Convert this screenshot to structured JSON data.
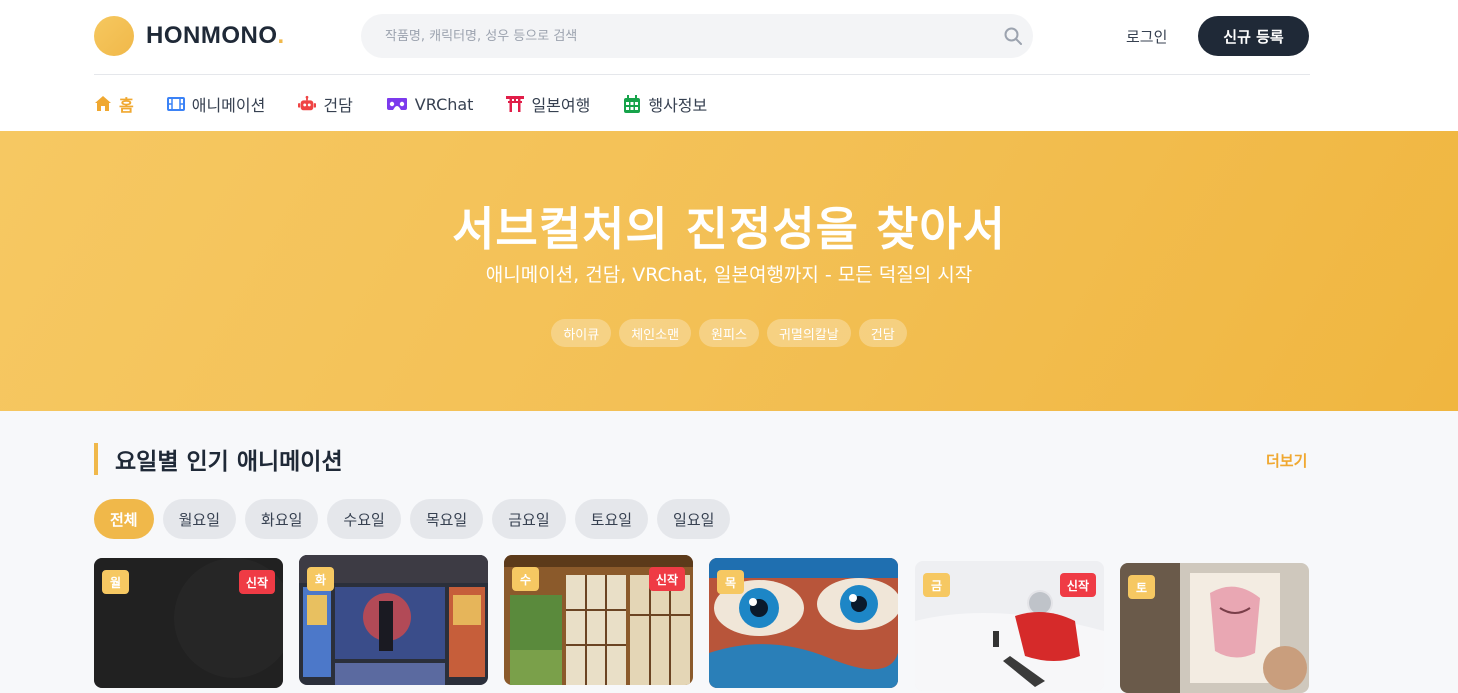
{
  "brand": {
    "name": "HONMONO",
    "dot": "."
  },
  "search": {
    "placeholder": "작품명, 캐릭터명, 성우 등으로 검색"
  },
  "auth": {
    "login": "로그인",
    "signup": "신규 등록"
  },
  "nav": [
    {
      "label": "홈",
      "icon": "home-icon",
      "color": "#f0a830"
    },
    {
      "label": "애니메이션",
      "icon": "film-icon",
      "color": "#3b82f6"
    },
    {
      "label": "건담",
      "icon": "robot-icon",
      "color": "#ef4444"
    },
    {
      "label": "VRChat",
      "icon": "vr-headset-icon",
      "color": "#7c3aed"
    },
    {
      "label": "일본여행",
      "icon": "torii-icon",
      "color": "#e11d48"
    },
    {
      "label": "행사정보",
      "icon": "calendar-icon",
      "color": "#16a34a"
    }
  ],
  "hero": {
    "title": "서브컬처의 진정성을 찾아서",
    "subtitle": "애니메이션, 건담, VRChat, 일본여행까지 - 모든 덕질의 시작",
    "tags": [
      "하이큐",
      "체인소맨",
      "원피스",
      "귀멸의칼날",
      "건담"
    ]
  },
  "section": {
    "title": "요일별 인기 애니메이션",
    "more": "더보기",
    "tabs": [
      "전체",
      "월요일",
      "화요일",
      "수요일",
      "목요일",
      "금요일",
      "토요일",
      "일요일"
    ],
    "active_tab": "전체"
  },
  "cards": [
    {
      "day": "월",
      "new": "신작"
    },
    {
      "day": "화",
      "new": ""
    },
    {
      "day": "수",
      "new": "신작"
    },
    {
      "day": "목",
      "new": ""
    },
    {
      "day": "금",
      "new": "신작"
    },
    {
      "day": "토",
      "new": ""
    }
  ]
}
